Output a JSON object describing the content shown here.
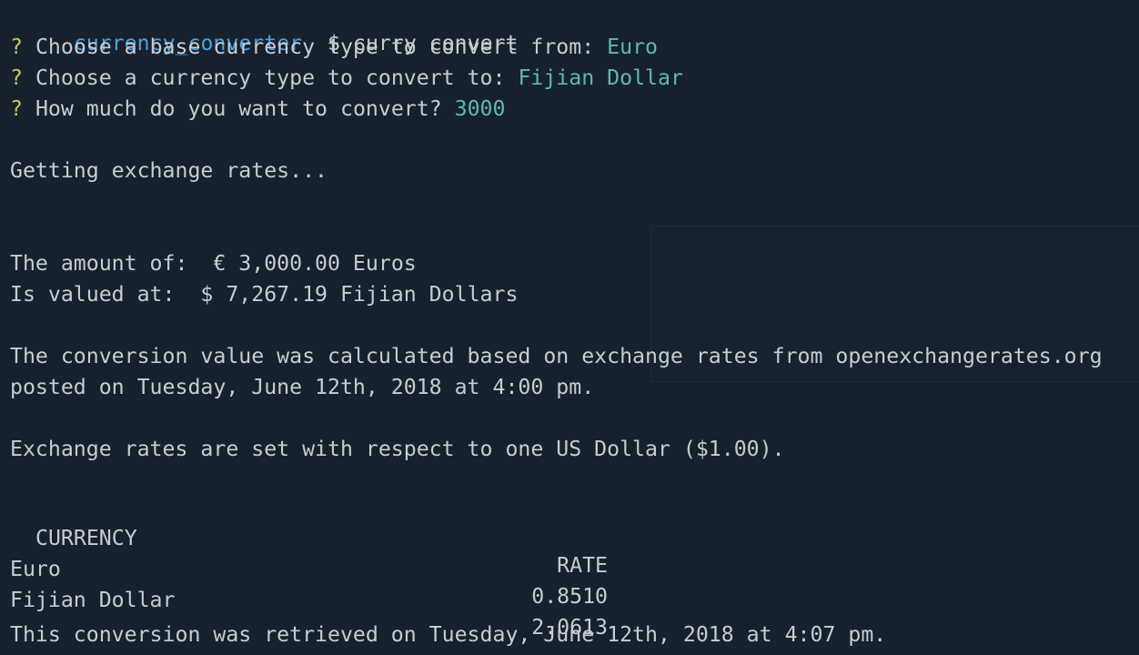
{
  "prompt": {
    "directory": "currency_converter",
    "symbol": "$",
    "command": "curry convert"
  },
  "questions": [
    {
      "mark": "?",
      "text": "Choose a base currency type to convert from:",
      "answer": "Euro"
    },
    {
      "mark": "?",
      "text": "Choose a currency type to convert to:",
      "answer": "Fijian Dollar"
    },
    {
      "mark": "?",
      "text": "How much do you want to convert?",
      "answer": "3000"
    }
  ],
  "status": "Getting exchange rates...",
  "result": {
    "amount_label": "The amount of:",
    "amount_value": "€ 3,000.00 Euros",
    "valued_label": "Is valued at:",
    "valued_value": "$ 7,267.19 Fijian Dollars"
  },
  "note": {
    "line1": "The conversion value was calculated based on exchange rates from openexchangerates.org",
    "line2": "posted on Tuesday, June 12th, 2018 at 4:00 pm."
  },
  "basis": "Exchange rates are set with respect to one US Dollar ($1.00).",
  "table": {
    "headers": {
      "currency": "CURRENCY",
      "rate": "RATE"
    },
    "rows": [
      {
        "currency": "Euro",
        "rate": "0.8510"
      },
      {
        "currency": "Fijian Dollar",
        "rate": "2.0613"
      }
    ]
  },
  "footer": "This conversion was retrieved on Tuesday, June 12th, 2018 at 4:07 pm.",
  "colors": {
    "background": "#17212e",
    "text": "#c6ccd4",
    "directory": "#4f9fdc",
    "question_mark": "#c9c35a",
    "answer": "#5fb9ad"
  }
}
